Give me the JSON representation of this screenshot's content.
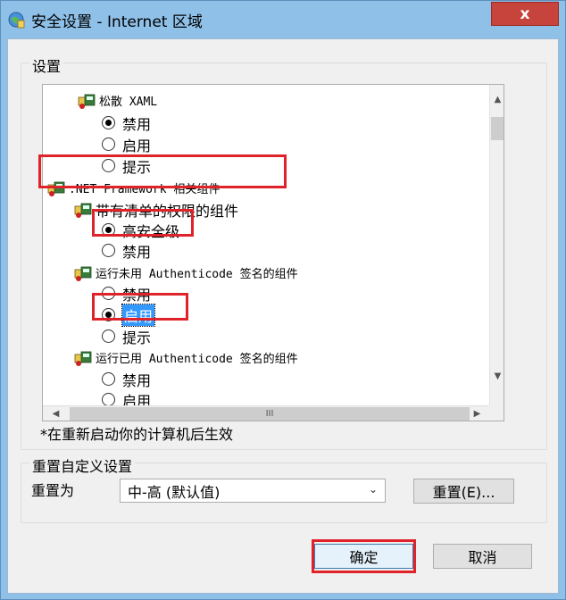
{
  "window": {
    "title": "安全设置 - Internet 区域",
    "close_label": "x"
  },
  "settings": {
    "group_label": "设置",
    "items": [
      {
        "kind": "category",
        "label": "松散 XAML"
      },
      {
        "kind": "option",
        "label": "禁用",
        "checked": true
      },
      {
        "kind": "option",
        "label": "启用",
        "checked": false
      },
      {
        "kind": "option",
        "label": "提示",
        "checked": false
      },
      {
        "kind": "category",
        "label": ".NET Framework 相关组件"
      },
      {
        "kind": "category",
        "label": "带有清单的权限的组件"
      },
      {
        "kind": "option",
        "label": "高安全级",
        "checked": true
      },
      {
        "kind": "option",
        "label": "禁用",
        "checked": false
      },
      {
        "kind": "category",
        "label": "运行未用 Authenticode 签名的组件"
      },
      {
        "kind": "option",
        "label": "禁用",
        "checked": false
      },
      {
        "kind": "option",
        "label": "启用",
        "checked": true
      },
      {
        "kind": "option",
        "label": "提示",
        "checked": false
      },
      {
        "kind": "category",
        "label": "运行已用 Authenticode 签名的组件"
      },
      {
        "kind": "option",
        "label": "禁用",
        "checked": false
      },
      {
        "kind": "option",
        "label": "启用",
        "checked": false
      }
    ],
    "scroll_middle_glyph": "III",
    "note": "*在重新启动你的计算机后生效"
  },
  "reset": {
    "group_label": "重置自定义设置",
    "reset_to_label": "重置为",
    "selected_level": "中-高 (默认值)",
    "reset_button": "重置(E)..."
  },
  "footer": {
    "ok_label": "确定",
    "cancel_label": "取消"
  },
  "colors": {
    "highlight_box": "#e0222a",
    "selection": "#3399ff",
    "close_button": "#c7443c"
  }
}
